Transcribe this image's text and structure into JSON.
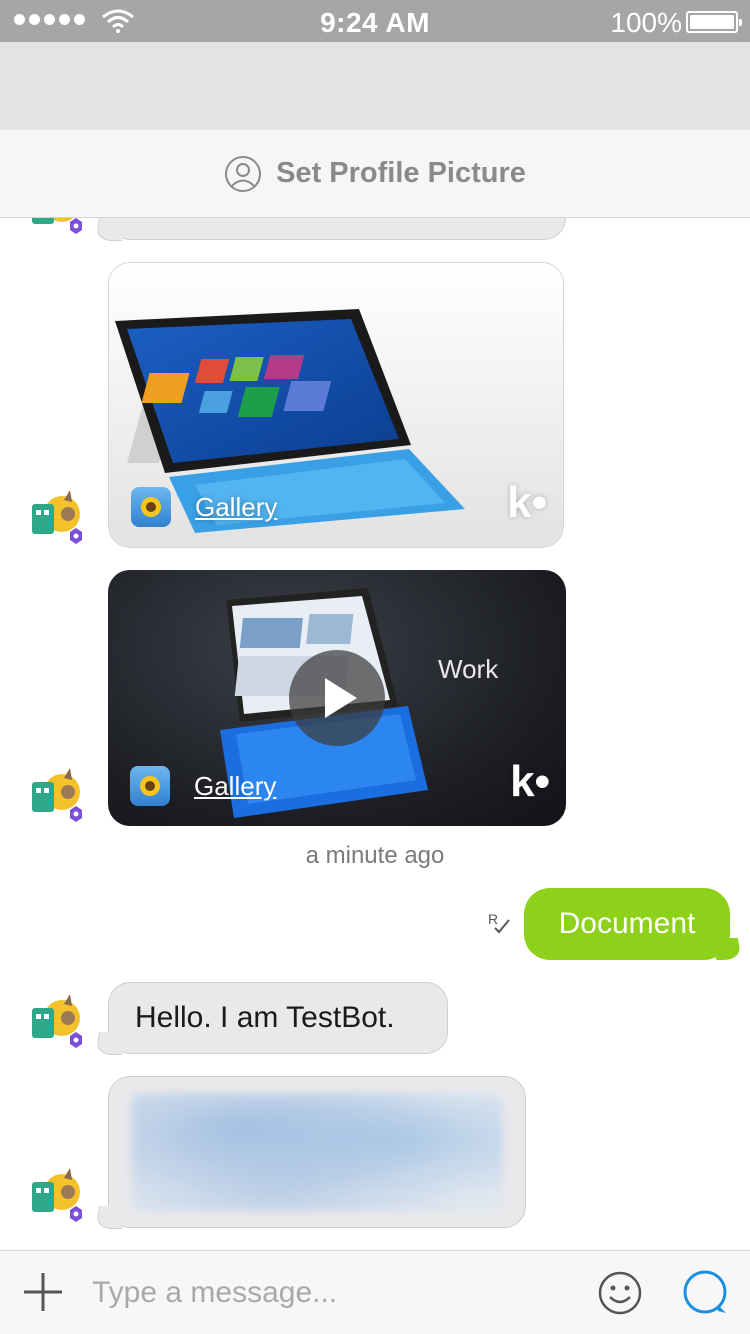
{
  "status_bar": {
    "time": "9:24 AM",
    "battery_percent": "100%",
    "signal_bars": 5
  },
  "header": {
    "profile_label": "Set Profile Picture"
  },
  "messages": {
    "card1": {
      "link_label": "Gallery",
      "brand": "k•"
    },
    "card2": {
      "link_label": "Gallery",
      "brand": "k•",
      "overlay_text": "Work"
    },
    "timestamp": "a minute ago",
    "outgoing": {
      "text": "Document",
      "receipt": "R"
    },
    "incoming_text": "Hello. I am TestBot."
  },
  "composer": {
    "placeholder": "Type a message..."
  },
  "colors": {
    "outgoing_bubble": "#8dd11a",
    "incoming_bubble": "#e9e9eb",
    "send_icon": "#1a90e0"
  },
  "icons": [
    "signal-dots",
    "wifi-icon",
    "battery-icon",
    "profile-icon",
    "gallery-app-icon",
    "play-icon",
    "read-receipt-icon",
    "plus-icon",
    "emoji-icon",
    "send-chat-icon"
  ]
}
